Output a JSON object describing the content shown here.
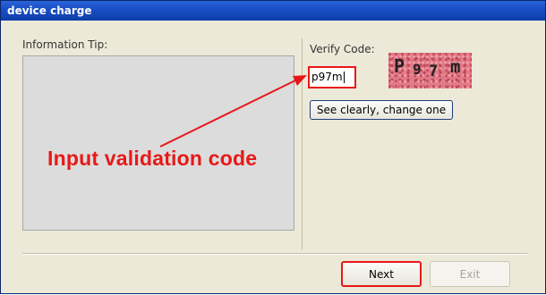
{
  "window": {
    "title": "device charge"
  },
  "info": {
    "label": "Information Tip:"
  },
  "verify": {
    "label": "Verify Code:",
    "input_value": "p97m",
    "captcha_chars": [
      "P",
      "9",
      "7",
      "m"
    ],
    "change_button": "See clearly, change one"
  },
  "annotation": {
    "text": "Input validation code",
    "color": "#e81818"
  },
  "buttons": {
    "next": "Next",
    "exit": "Exit"
  },
  "colors": {
    "titlebar": "#1a4fc6",
    "dialog_bg": "#ece9d8",
    "highlight": "#e81818",
    "captcha_bg": "#e07a86"
  }
}
